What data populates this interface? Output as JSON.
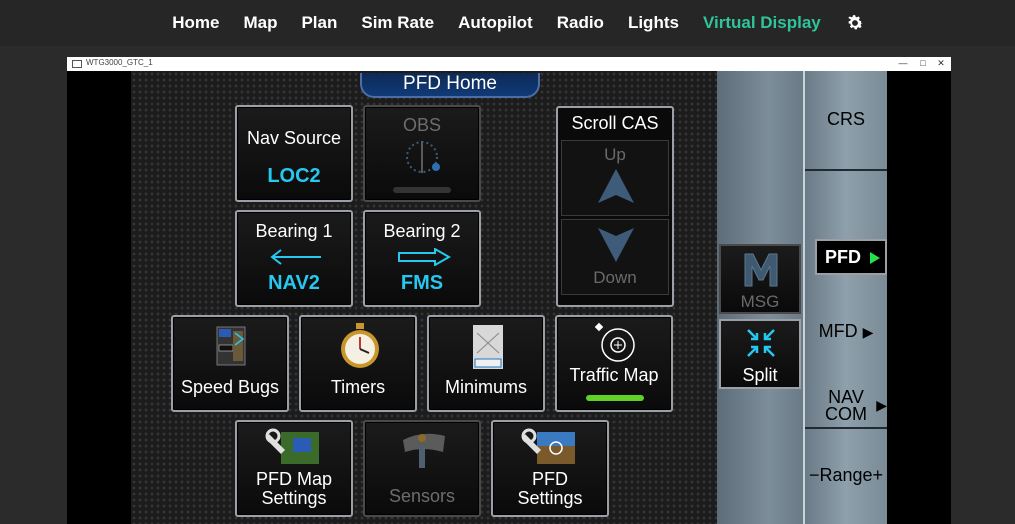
{
  "nav": {
    "items": [
      {
        "label": "Home"
      },
      {
        "label": "Map"
      },
      {
        "label": "Plan"
      },
      {
        "label": "Sim Rate"
      },
      {
        "label": "Autopilot"
      },
      {
        "label": "Radio"
      },
      {
        "label": "Lights"
      },
      {
        "label": "Virtual Display"
      }
    ],
    "active_color": "#2fc49a"
  },
  "window": {
    "title": "WTG3000_GTC_1",
    "minimize": "—",
    "maximize": "□",
    "close": "✕"
  },
  "screen": {
    "header": "PFD Home",
    "nav_source": {
      "label": "Nav Source",
      "value": "LOC2"
    },
    "obs": {
      "label": "OBS"
    },
    "scroll_cas": {
      "label": "Scroll CAS",
      "up": "Up",
      "down": "Down"
    },
    "bearing1": {
      "label": "Bearing 1",
      "value": "NAV2"
    },
    "bearing2": {
      "label": "Bearing 2",
      "value": "FMS"
    },
    "speed_bugs": {
      "label": "Speed Bugs"
    },
    "timers": {
      "label": "Timers"
    },
    "minimums": {
      "label": "Minimums"
    },
    "traffic_map": {
      "label": "Traffic Map"
    },
    "pfd_map_settings": {
      "line1": "PFD Map",
      "line2": "Settings"
    },
    "sensors": {
      "label": "Sensors"
    },
    "pfd_settings": {
      "line1": "PFD",
      "line2": "Settings"
    },
    "msg": {
      "label": "MSG"
    },
    "split": {
      "label": "Split"
    },
    "right": {
      "crs": "CRS",
      "pfd": "PFD",
      "mfd": "MFD",
      "nav": "NAV",
      "com": "COM",
      "range": "−Range+"
    }
  },
  "colors": {
    "value_cyan": "#27c7ef",
    "active_green": "#27e04a"
  }
}
